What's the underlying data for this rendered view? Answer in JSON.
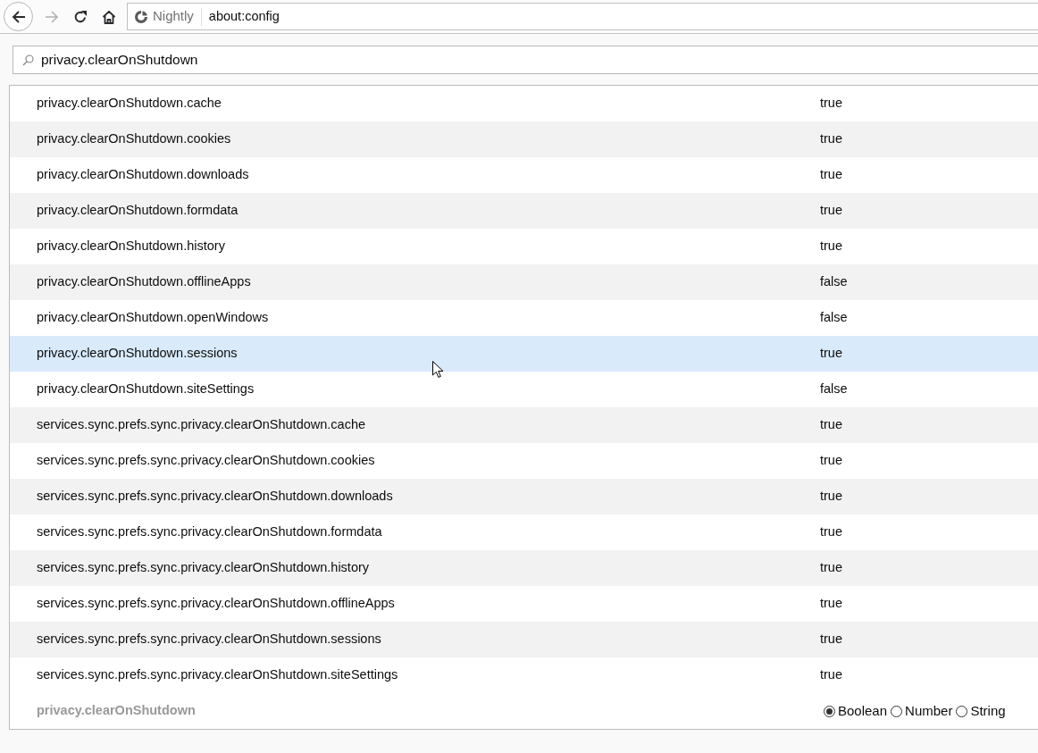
{
  "toolbar": {
    "buttons": [
      {
        "kind": "back",
        "disabled": false
      },
      {
        "kind": "forward",
        "disabled": true
      },
      {
        "kind": "reload",
        "disabled": false
      },
      {
        "kind": "home",
        "disabled": false
      }
    ],
    "url_bar": {
      "identity": "Nightly",
      "url": "about:config"
    }
  },
  "search": {
    "value": "privacy.clearOnShutdown"
  },
  "prefs": [
    {
      "name": "privacy.clearOnShutdown.cache",
      "value": "true",
      "selected": false
    },
    {
      "name": "privacy.clearOnShutdown.cookies",
      "value": "true",
      "selected": false
    },
    {
      "name": "privacy.clearOnShutdown.downloads",
      "value": "true",
      "selected": false
    },
    {
      "name": "privacy.clearOnShutdown.formdata",
      "value": "true",
      "selected": false
    },
    {
      "name": "privacy.clearOnShutdown.history",
      "value": "true",
      "selected": false
    },
    {
      "name": "privacy.clearOnShutdown.offlineApps",
      "value": "false",
      "selected": false
    },
    {
      "name": "privacy.clearOnShutdown.openWindows",
      "value": "false",
      "selected": false
    },
    {
      "name": "privacy.clearOnShutdown.sessions",
      "value": "true",
      "selected": true
    },
    {
      "name": "privacy.clearOnShutdown.siteSettings",
      "value": "false",
      "selected": false
    },
    {
      "name": "services.sync.prefs.sync.privacy.clearOnShutdown.cache",
      "value": "true",
      "selected": false
    },
    {
      "name": "services.sync.prefs.sync.privacy.clearOnShutdown.cookies",
      "value": "true",
      "selected": false
    },
    {
      "name": "services.sync.prefs.sync.privacy.clearOnShutdown.downloads",
      "value": "true",
      "selected": false
    },
    {
      "name": "services.sync.prefs.sync.privacy.clearOnShutdown.formdata",
      "value": "true",
      "selected": false
    },
    {
      "name": "services.sync.prefs.sync.privacy.clearOnShutdown.history",
      "value": "true",
      "selected": false
    },
    {
      "name": "services.sync.prefs.sync.privacy.clearOnShutdown.offlineApps",
      "value": "true",
      "selected": false
    },
    {
      "name": "services.sync.prefs.sync.privacy.clearOnShutdown.sessions",
      "value": "true",
      "selected": false
    },
    {
      "name": "services.sync.prefs.sync.privacy.clearOnShutdown.siteSettings",
      "value": "true",
      "selected": false
    }
  ],
  "new_pref": {
    "name": "privacy.clearOnShutdown",
    "types": [
      {
        "label": "Boolean",
        "selected": true
      },
      {
        "label": "Number",
        "selected": false
      },
      {
        "label": "String",
        "selected": false
      }
    ]
  }
}
